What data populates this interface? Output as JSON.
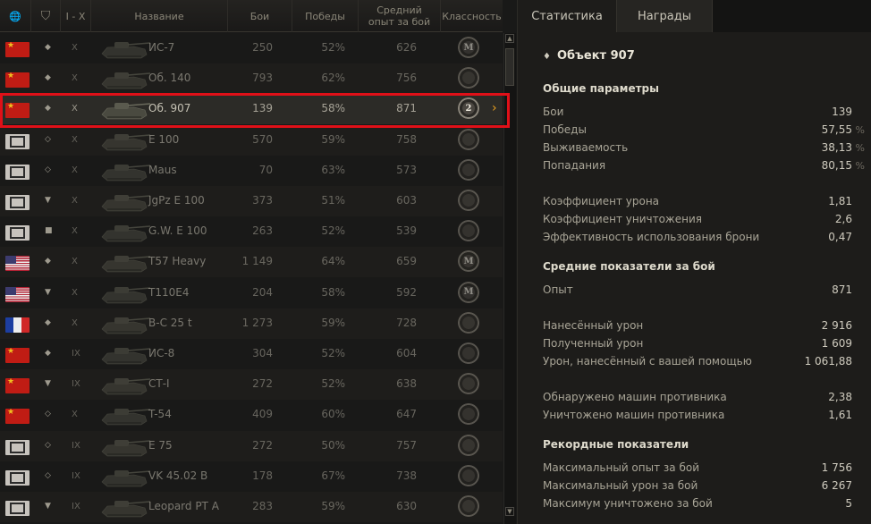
{
  "header": {
    "col_nation_icon": "globe-icon",
    "col_type_icon": "vehicle-type-icon",
    "col_tier": "I - X",
    "col_name": "Название",
    "col_battles": "Бои",
    "col_wins": "Победы",
    "col_avg_xp": "Средний опыт за бой",
    "col_class": "Классность"
  },
  "tabs": {
    "stats": "Статистика",
    "awards": "Награды"
  },
  "rows": [
    {
      "nation": "ussr",
      "type": "heavy",
      "tier": "X",
      "name": "ИС-7",
      "battles": "250",
      "wins": "52%",
      "xp": "626",
      "medal": "M",
      "selected": false
    },
    {
      "nation": "ussr",
      "type": "heavy",
      "tier": "X",
      "name": "Об. 140",
      "battles": "793",
      "wins": "62%",
      "xp": "756",
      "medal": "",
      "selected": false
    },
    {
      "nation": "ussr",
      "type": "heavy",
      "tier": "X",
      "name": "Об. 907",
      "battles": "139",
      "wins": "58%",
      "xp": "871",
      "medal": "2",
      "selected": true
    },
    {
      "nation": "ger",
      "type": "medium",
      "tier": "X",
      "name": "E 100",
      "battles": "570",
      "wins": "59%",
      "xp": "758",
      "medal": "",
      "selected": false
    },
    {
      "nation": "ger",
      "type": "medium",
      "tier": "X",
      "name": "Maus",
      "battles": "70",
      "wins": "63%",
      "xp": "573",
      "medal": "",
      "selected": false
    },
    {
      "nation": "ger",
      "type": "td",
      "tier": "X",
      "name": "JgPz E 100",
      "battles": "373",
      "wins": "51%",
      "xp": "603",
      "medal": "",
      "selected": false
    },
    {
      "nation": "ger",
      "type": "spg",
      "tier": "X",
      "name": "G.W. E 100",
      "battles": "263",
      "wins": "52%",
      "xp": "539",
      "medal": "",
      "selected": false
    },
    {
      "nation": "usa",
      "type": "heavy",
      "tier": "X",
      "name": "T57 Heavy",
      "battles": "1 149",
      "wins": "64%",
      "xp": "659",
      "medal": "M",
      "selected": false
    },
    {
      "nation": "usa",
      "type": "td",
      "tier": "X",
      "name": "T110E4",
      "battles": "204",
      "wins": "58%",
      "xp": "592",
      "medal": "M",
      "selected": false
    },
    {
      "nation": "fra",
      "type": "heavy",
      "tier": "X",
      "name": "B-C 25 t",
      "battles": "1 273",
      "wins": "59%",
      "xp": "728",
      "medal": "",
      "selected": false
    },
    {
      "nation": "ussr",
      "type": "heavy",
      "tier": "IX",
      "name": "ИС-8",
      "battles": "304",
      "wins": "52%",
      "xp": "604",
      "medal": "",
      "selected": false
    },
    {
      "nation": "ussr",
      "type": "td",
      "tier": "IX",
      "name": "СТ-I",
      "battles": "272",
      "wins": "52%",
      "xp": "638",
      "medal": "",
      "selected": false
    },
    {
      "nation": "ussr",
      "type": "medium",
      "tier": "X",
      "name": "T-54",
      "battles": "409",
      "wins": "60%",
      "xp": "647",
      "medal": "",
      "selected": false
    },
    {
      "nation": "ger",
      "type": "medium",
      "tier": "IX",
      "name": "E 75",
      "battles": "272",
      "wins": "50%",
      "xp": "757",
      "medal": "",
      "selected": false
    },
    {
      "nation": "ger",
      "type": "medium",
      "tier": "IX",
      "name": "VK 45.02 B",
      "battles": "178",
      "wins": "67%",
      "xp": "738",
      "medal": "",
      "selected": false
    },
    {
      "nation": "ger",
      "type": "td",
      "tier": "IX",
      "name": "Leopard PT A",
      "battles": "283",
      "wins": "59%",
      "xp": "630",
      "medal": "",
      "selected": false
    }
  ],
  "stats": {
    "vehicle_name": "Объект 907",
    "general_title": "Общие параметры",
    "general": [
      {
        "label": "Бои",
        "value": "139",
        "pct": ""
      },
      {
        "label": "Победы",
        "value": "57,55",
        "pct": "%"
      },
      {
        "label": "Выживаемость",
        "value": "38,13",
        "pct": "%"
      },
      {
        "label": "Попадания",
        "value": "80,15",
        "pct": "%"
      }
    ],
    "coef": [
      {
        "label": "Коэффициент урона",
        "value": "1,81"
      },
      {
        "label": "Коэффициент уничтожения",
        "value": "2,6"
      },
      {
        "label": "Эффективность использования брони",
        "value": "0,47"
      }
    ],
    "avg_title": "Средние показатели за бой",
    "avg": [
      {
        "label": "Опыт",
        "value": "871"
      },
      {
        "label": "Нанесённый урон",
        "value": "2 916"
      },
      {
        "label": "Полученный урон",
        "value": "1 609"
      },
      {
        "label": "Урон, нанесённый с вашей помощью",
        "value": "1 061,88"
      },
      {
        "label": "Обнаружено машин противника",
        "value": "2,38"
      },
      {
        "label": "Уничтожено машин противника",
        "value": "1,61"
      }
    ],
    "record_title": "Рекордные показатели",
    "record": [
      {
        "label": "Максимальный опыт за бой",
        "value": "1 756"
      },
      {
        "label": "Максимальный урон за бой",
        "value": "6 267"
      },
      {
        "label": "Максимум уничтожено за бой",
        "value": "5"
      }
    ]
  },
  "colors": {
    "accent": "#e8a020",
    "selection_border": "#e01018",
    "panel_bg": "#1d1c1a"
  }
}
